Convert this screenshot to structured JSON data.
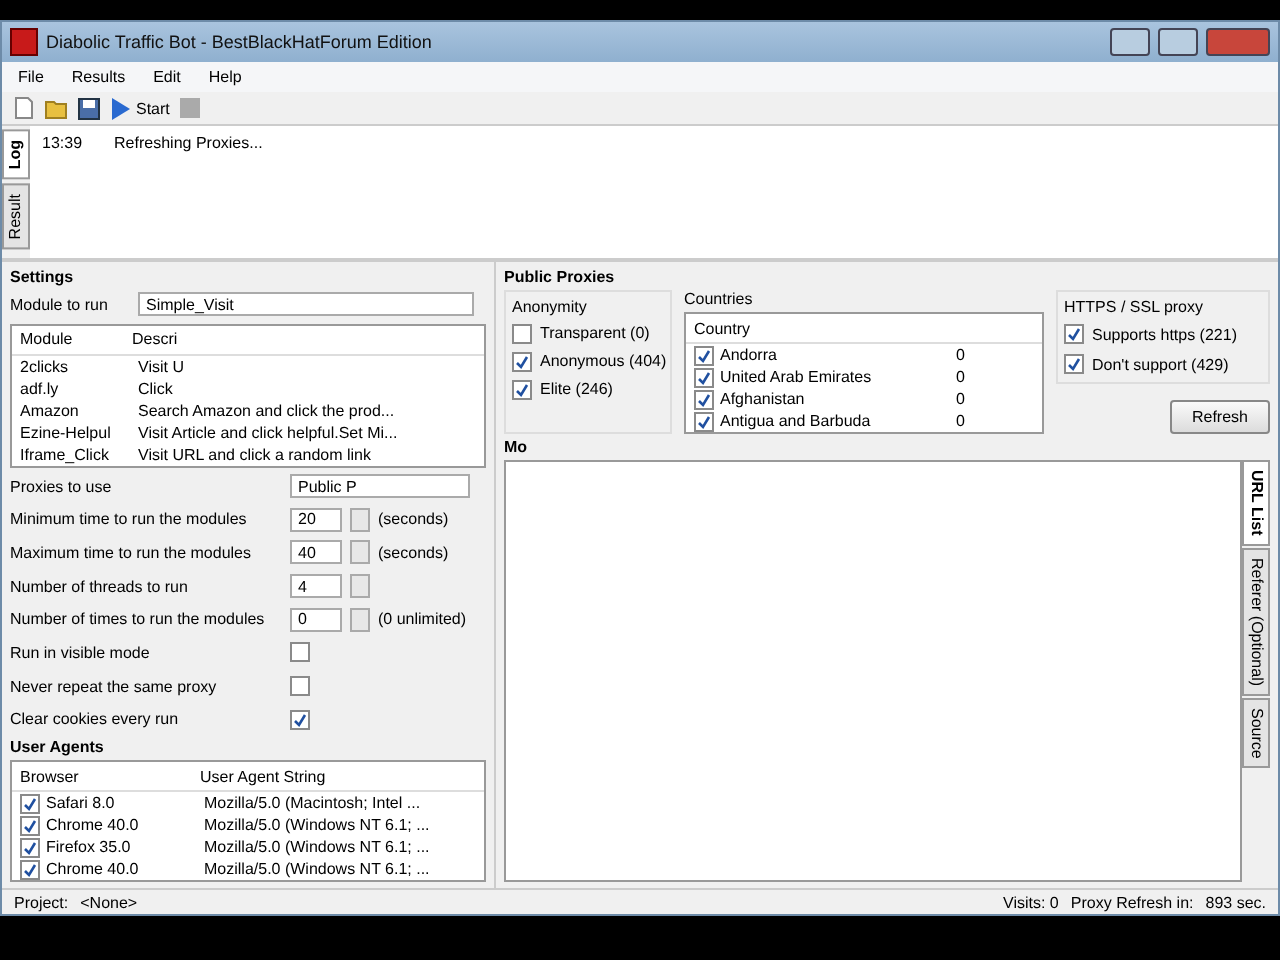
{
  "window": {
    "title": "Diabolic Traffic Bot - BestBlackHatForum Edition"
  },
  "menu": [
    "File",
    "Results",
    "Edit",
    "Help"
  ],
  "toolbar": {
    "start": "Start"
  },
  "log": {
    "tabs": [
      {
        "label": "Log",
        "selected": true
      },
      {
        "label": "Result",
        "selected": false
      }
    ],
    "entries": [
      {
        "time": "13:39",
        "message": "Refreshing Proxies..."
      }
    ]
  },
  "settings": {
    "title": "Settings",
    "module_label": "Module to run",
    "module_value": "Simple_Visit",
    "modules": {
      "columns": [
        "Module",
        "Descri"
      ],
      "rows": [
        {
          "module": "2clicks",
          "description": "Visit U"
        },
        {
          "module": "adf.ly",
          "description": "Click"
        },
        {
          "module": "Amazon",
          "description": "Search Amazon and click the prod..."
        },
        {
          "module": "Ezine-Helpul",
          "description": "Visit Article and click helpful.Set Mi..."
        },
        {
          "module": "Iframe_Click",
          "description": "Visit URL and click a random link"
        }
      ]
    },
    "fields": [
      {
        "kind": "select",
        "label": "Proxies to use",
        "value": "Public P"
      },
      {
        "kind": "spin",
        "label": "Minimum time to run the modules",
        "value": "20",
        "unit": "(seconds)"
      },
      {
        "kind": "spin",
        "label": "Maximum time to run the modules",
        "value": "40",
        "unit": "(seconds)"
      },
      {
        "kind": "spin",
        "label": "Number of threads to run",
        "value": "4"
      },
      {
        "kind": "spin",
        "label": "Number of times to run the modules",
        "value": "0",
        "unit": "(0 unlimited)"
      },
      {
        "kind": "check",
        "label": "Run in visible mode",
        "checked": false
      },
      {
        "kind": "check",
        "label": "Never repeat the same proxy",
        "checked": false
      },
      {
        "kind": "check",
        "label": "Clear cookies every run",
        "checked": true
      }
    ]
  },
  "user_agents": {
    "title": "User Agents",
    "columns": [
      "Browser",
      "User Agent String"
    ],
    "rows": [
      {
        "browser": "Safari 8.0",
        "agent": "Mozilla/5.0 (Macintosh; Intel ...",
        "checked": true
      },
      {
        "browser": "Chrome 40.0",
        "agent": "Mozilla/5.0 (Windows NT 6.1; ...",
        "checked": true
      },
      {
        "browser": "Firefox 35.0",
        "agent": "Mozilla/5.0 (Windows NT 6.1; ...",
        "checked": true
      },
      {
        "browser": "Chrome 40.0",
        "agent": "Mozilla/5.0 (Windows NT 6.1; ...",
        "checked": true
      }
    ]
  },
  "public_proxies": {
    "title": "Public Proxies",
    "anonymity": {
      "title": "Anonymity",
      "items": [
        {
          "label": "Transparent (0)",
          "checked": false
        },
        {
          "label": "Anonymous (404)",
          "checked": true
        },
        {
          "label": "Elite (246)",
          "checked": true
        }
      ]
    },
    "countries": {
      "title": "Countries",
      "column": "Country",
      "rows": [
        {
          "name": "Andorra",
          "count": "0",
          "checked": true
        },
        {
          "name": "United Arab Emirates",
          "count": "0",
          "checked": true
        },
        {
          "name": "Afghanistan",
          "count": "0",
          "checked": true
        },
        {
          "name": "Antigua and Barbuda",
          "count": "0",
          "checked": true
        }
      ]
    },
    "ssl": {
      "title": "HTTPS / SSL proxy",
      "items": [
        {
          "label": "Supports https (221)",
          "checked": true
        },
        {
          "label": "Don't support (429)",
          "checked": true
        }
      ]
    },
    "refresh": "Refresh"
  },
  "modules_panel": {
    "title": "Mo",
    "tabs": [
      {
        "label": "URL List",
        "selected": true
      },
      {
        "label": "Referer (Optional)",
        "selected": false
      },
      {
        "label": "Source",
        "selected": false
      }
    ]
  },
  "status_bar": {
    "project_label": "Project:",
    "project": "<None>",
    "visits": "Visits:  0",
    "proxy_refresh": "Proxy Refresh in:",
    "seconds": "893 sec."
  }
}
